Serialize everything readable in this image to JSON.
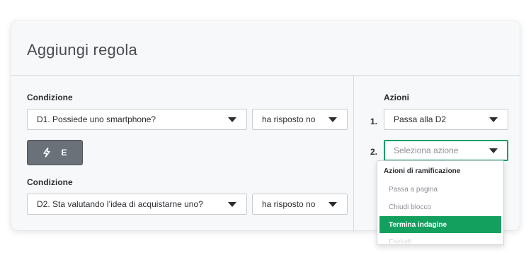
{
  "dialog": {
    "title": "Aggiungi regola"
  },
  "left": {
    "condition1": {
      "label": "Condizione",
      "question": "D1. Possiede uno smartphone?",
      "answer": "ha risposto no"
    },
    "and_button": {
      "label": "E",
      "icon": "lightning-icon"
    },
    "condition2": {
      "label": "Condizione",
      "question": "D2. Sta valutando l’idea di acquistarne uno?",
      "answer": "ha risposto no"
    }
  },
  "right": {
    "label": "Azioni",
    "actions": [
      {
        "number": "1.",
        "value": "Passa alla D2"
      },
      {
        "number": "2.",
        "placeholder": "Seleziona azione"
      }
    ],
    "dropdown": {
      "header": "Azioni di ramificazione",
      "items": [
        "Passa a pagina",
        "Chiudi blocco",
        "Termina indagine",
        "Escludi"
      ],
      "highlighted": "Termina indagine"
    }
  },
  "colors": {
    "accent": "#13a05f",
    "button": "#6b7178"
  }
}
